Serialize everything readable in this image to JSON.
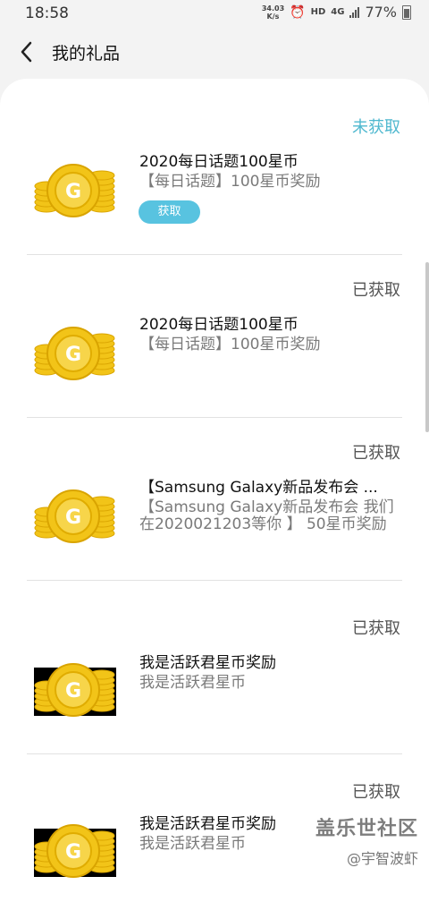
{
  "status_bar": {
    "time": "18:58",
    "net_speed": "34.03",
    "net_unit": "K/s",
    "hd": "HD",
    "net_type": "4G",
    "battery": "77%"
  },
  "header": {
    "title": "我的礼品"
  },
  "gifts": [
    {
      "status": "未获取",
      "title": "2020每日话题100星币",
      "desc": "【每日话题】100星币奖励",
      "button": "获取"
    },
    {
      "status": "已获取",
      "title": "2020每日话题100星币",
      "desc": "【每日话题】100星币奖励"
    },
    {
      "status": "已获取",
      "title": "【Samsung Galaxy新品发布会 ...",
      "desc": "【Samsung Galaxy新品发布会 我们在2020021203等你 】 50星币奖励"
    },
    {
      "status": "已获取",
      "title": "我是活跃君星币奖励",
      "desc": "我是活跃君星币"
    },
    {
      "status": "已获取",
      "title": "我是活跃君星币奖励",
      "desc": "我是活跃君星币"
    }
  ],
  "watermark": {
    "logo": "盖乐世社区",
    "author": "@宇智波虾"
  },
  "colors": {
    "accent": "#4fb8cf",
    "button": "#58c3e0",
    "coin": "#f2c418"
  }
}
